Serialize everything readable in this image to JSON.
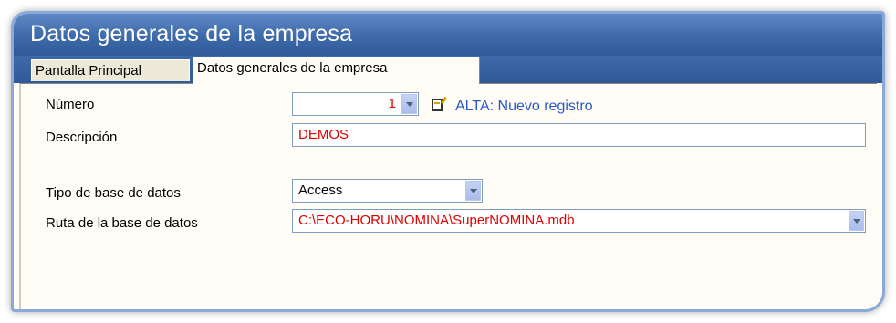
{
  "window": {
    "title": "Datos generales de la empresa"
  },
  "tabs": [
    {
      "label": "Pantalla Principal"
    },
    {
      "label": "Datos generales de la empresa"
    }
  ],
  "form": {
    "numero": {
      "label": "Número",
      "value": "1"
    },
    "status": {
      "text": "ALTA: Nuevo registro"
    },
    "descripcion": {
      "label": "Descripción",
      "value": "DEMOS"
    },
    "tipo_bd": {
      "label": "Tipo de base de datos",
      "value": "Access"
    },
    "ruta_bd": {
      "label": "Ruta de la base de datos",
      "value": "C:\\ECO-HORU\\NOMINA\\SuperNOMINA.mdb"
    }
  },
  "colors": {
    "titlebar": "#3e6aaa",
    "value_text": "#e00000",
    "status_text": "#2b57c7"
  }
}
